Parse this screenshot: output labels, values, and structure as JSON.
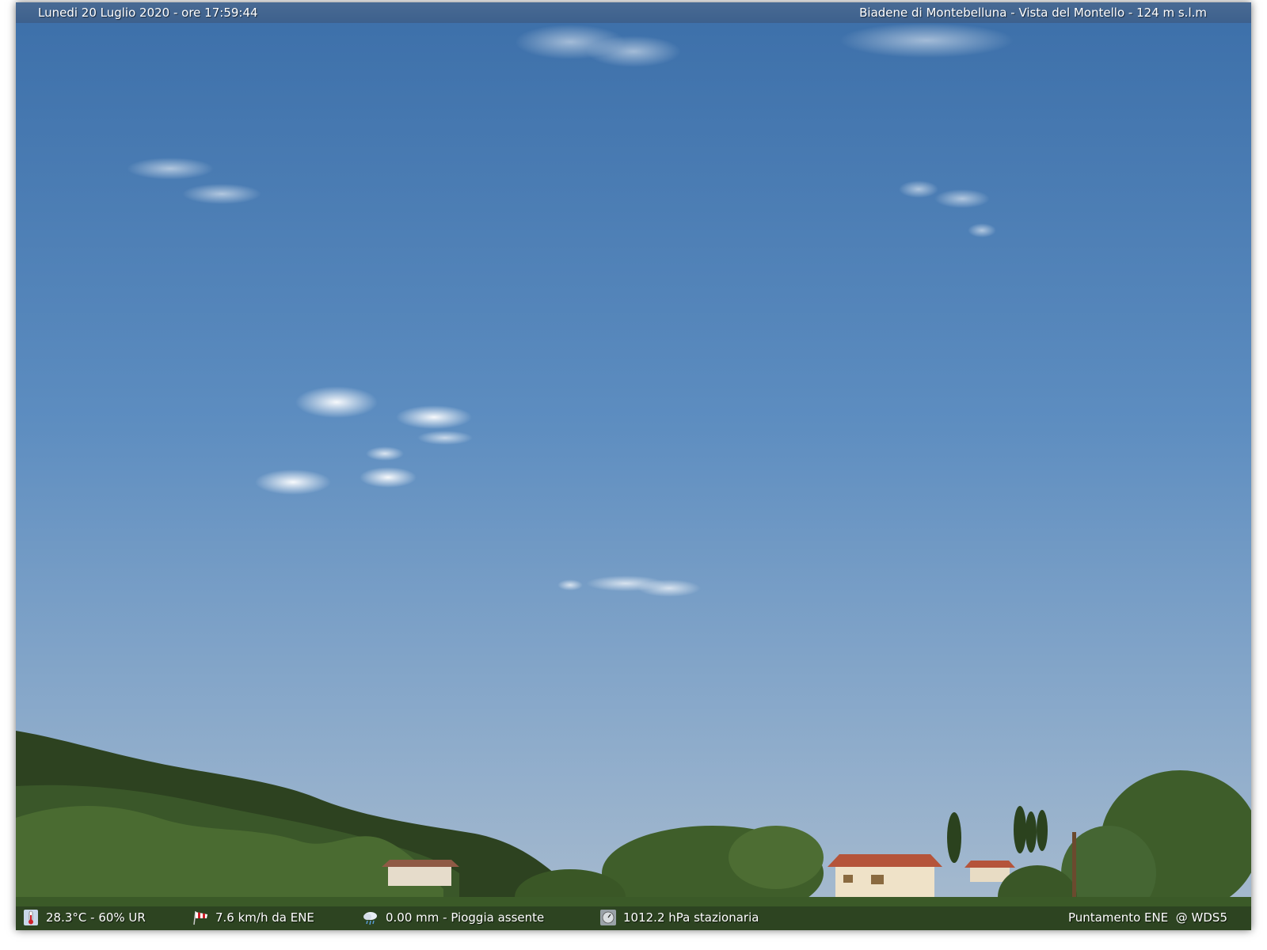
{
  "header": {
    "datetime": "Lunedi 20 Luglio 2020 - ore 17:59:44",
    "location": "Biadene di Montebelluna - Vista del Montello - 124 m s.l.m"
  },
  "footer": {
    "temperature": {
      "icon": "thermometer-icon",
      "text": "28.3°C - 60% UR"
    },
    "wind": {
      "icon": "windsock-icon",
      "text": "7.6 km/h da ENE"
    },
    "rain": {
      "icon": "rain-cloud-icon",
      "text": "0.00 mm - Pioggia assente"
    },
    "pressure": {
      "icon": "barometer-icon",
      "text": "1012.2 hPa stazionaria"
    },
    "pointing": "Puntamento ENE  @ WDS5"
  },
  "colors": {
    "sky_top": "#3f74ad",
    "sky_horizon": "#9fb7cf",
    "vegetation": "#2f4a22",
    "roof": "#b5543a"
  }
}
